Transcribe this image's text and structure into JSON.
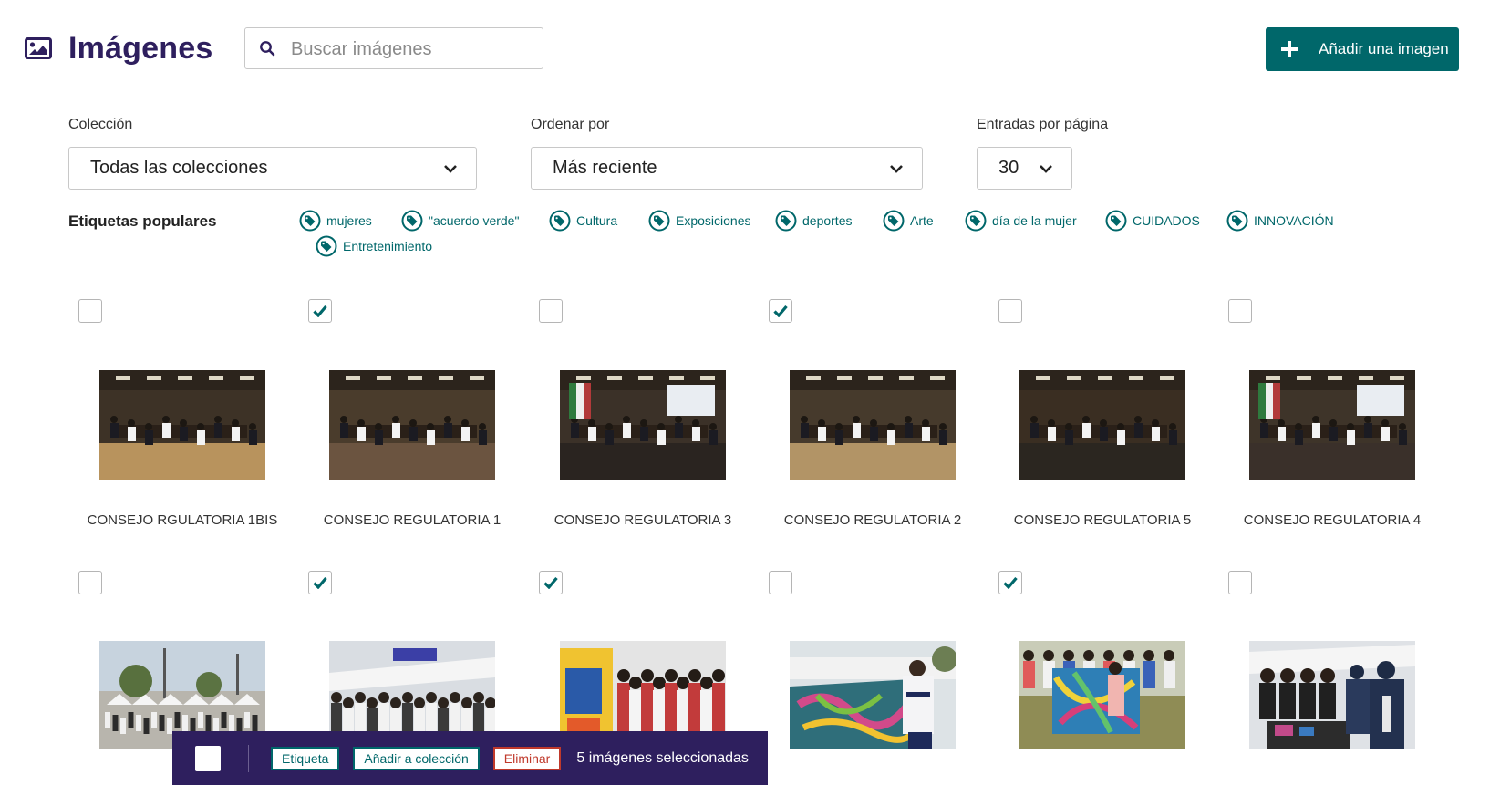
{
  "header": {
    "title": "Imágenes",
    "search_placeholder": "Buscar imágenes",
    "add_button_label": "Añadir una imagen"
  },
  "filters": {
    "collection": {
      "label": "Colección",
      "value": "Todas las colecciones"
    },
    "order": {
      "label": "Ordenar por",
      "value": "Más reciente"
    },
    "per_page": {
      "label": "Entradas por página",
      "value": "30"
    }
  },
  "tags": {
    "title": "Etiquetas populares",
    "items": [
      "mujeres",
      "\"acuerdo verde\"",
      "Cultura",
      "Exposiciones",
      "deportes",
      "Arte",
      "día de la mujer",
      "CUIDADOS",
      "INNOVACIÓN",
      "Entretenimiento"
    ]
  },
  "images": [
    {
      "caption": "CONSEJO RGULATORIA 1BIS",
      "checked": false
    },
    {
      "caption": "CONSEJO REGULATORIA 1",
      "checked": true
    },
    {
      "caption": "CONSEJO REGULATORIA 3",
      "checked": false
    },
    {
      "caption": "CONSEJO REGULATORIA 2",
      "checked": true
    },
    {
      "caption": "CONSEJO REGULATORIA 5",
      "checked": false
    },
    {
      "caption": "CONSEJO REGULATORIA 4",
      "checked": false
    },
    {
      "caption": "",
      "checked": false
    },
    {
      "caption": "",
      "checked": true
    },
    {
      "caption": "",
      "checked": true
    },
    {
      "caption": "",
      "checked": false
    },
    {
      "caption": "",
      "checked": true
    },
    {
      "caption": "",
      "checked": false
    }
  ],
  "action_bar": {
    "tag_label": "Etiqueta",
    "add_to_collection_label": "Añadir a colección",
    "delete_label": "Eliminar",
    "status": "5 imágenes seleccionadas"
  },
  "colors": {
    "brand": "#2e1f5e",
    "accent": "#00676a",
    "danger": "#c0392b"
  },
  "icons": [
    "image-icon",
    "search-icon",
    "plus-icon",
    "chevron-down-icon",
    "tag-icon",
    "checkmark-icon"
  ]
}
